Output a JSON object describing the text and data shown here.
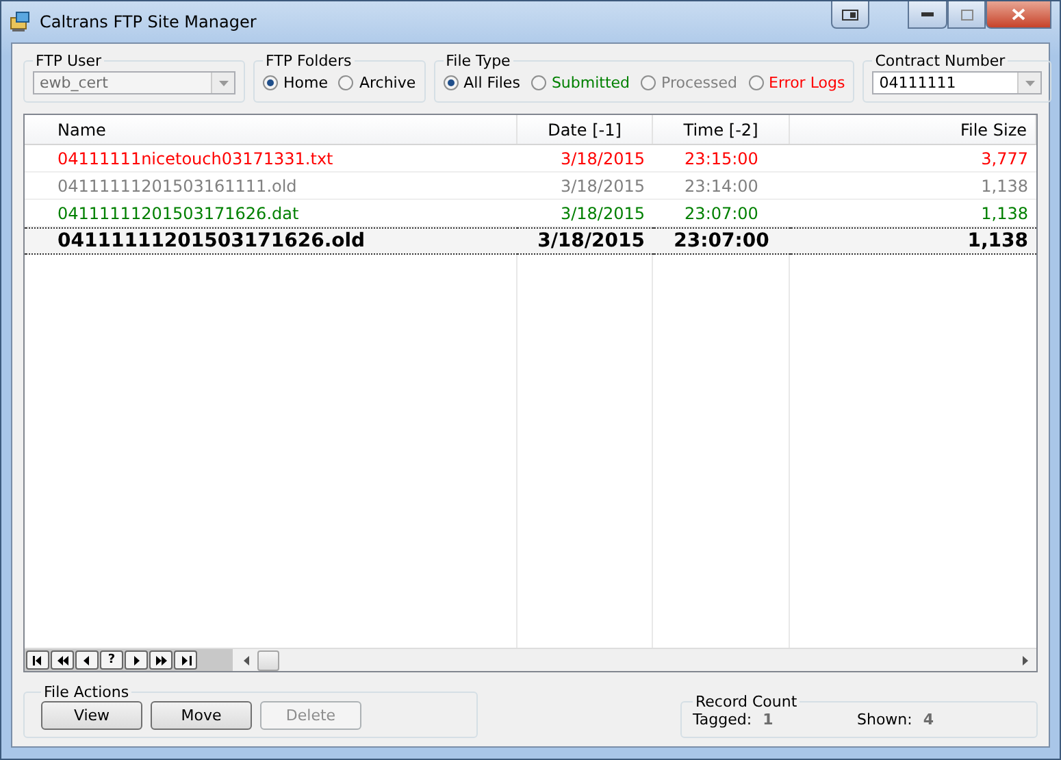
{
  "window": {
    "title": "Caltrans FTP Site Manager"
  },
  "ftp_user": {
    "label": "FTP User",
    "value": "ewb_cert",
    "disabled": true
  },
  "ftp_folders": {
    "label": "FTP Folders",
    "options": [
      {
        "label": "Home",
        "selected": true
      },
      {
        "label": "Archive",
        "selected": false
      }
    ]
  },
  "file_type": {
    "label": "File Type",
    "options": [
      {
        "label": "All Files",
        "selected": true,
        "color": "#000000"
      },
      {
        "label": "Submitted",
        "selected": false,
        "color": "#008000"
      },
      {
        "label": "Processed",
        "selected": false,
        "color": "#808080"
      },
      {
        "label": "Error Logs",
        "selected": false,
        "color": "#ff0000"
      }
    ]
  },
  "contract_number": {
    "label": "Contract Number",
    "value": "04111111"
  },
  "table": {
    "columns": [
      "Name",
      "Date [-1]",
      "Time [-2]",
      "File Size"
    ],
    "rows": [
      {
        "cells": [
          "04111111nicetouch03171331.txt",
          "3/18/2015",
          "23:15:00",
          "3,777"
        ],
        "color": "#ff0000",
        "tagged": false
      },
      {
        "cells": [
          "04111111201503161111.old",
          "3/18/2015",
          "23:14:00",
          "1,138"
        ],
        "color": "#808080",
        "tagged": false
      },
      {
        "cells": [
          "04111111201503171626.dat",
          "3/18/2015",
          "23:07:00",
          "1,138"
        ],
        "color": "#008000",
        "tagged": false
      },
      {
        "cells": [
          "04111111201503171626.old",
          "3/18/2015",
          "23:07:00",
          "1,138"
        ],
        "color": "#000000",
        "tagged": true
      }
    ]
  },
  "navigator": [
    {
      "kind": "first"
    },
    {
      "kind": "prev-page"
    },
    {
      "kind": "prev"
    },
    {
      "kind": "find",
      "label": "?"
    },
    {
      "kind": "next"
    },
    {
      "kind": "next-page"
    },
    {
      "kind": "last"
    }
  ],
  "file_actions": {
    "label": "File Actions",
    "buttons": [
      {
        "label": "View",
        "disabled": false
      },
      {
        "label": "Move",
        "disabled": false
      },
      {
        "label": "Delete",
        "disabled": true
      }
    ]
  },
  "record_count": {
    "label": "Record Count",
    "tagged_label": "Tagged:",
    "tagged": "1",
    "shown_label": "Shown:",
    "shown": "4"
  }
}
